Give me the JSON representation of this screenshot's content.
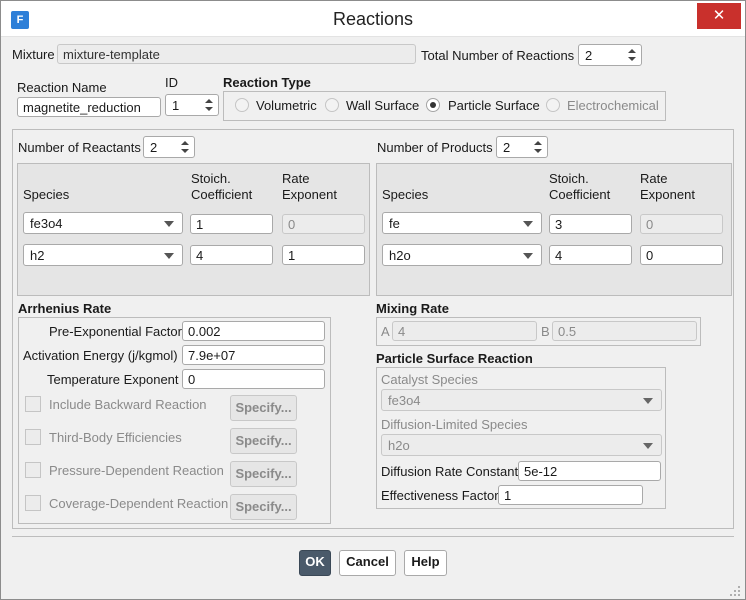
{
  "window": {
    "title": "Reactions",
    "app_icon": "F",
    "close_glyph": "✕"
  },
  "mixture": {
    "label": "Mixture",
    "value": "mixture-template"
  },
  "total_reactions": {
    "label": "Total Number of Reactions",
    "value": "2"
  },
  "reaction_name": {
    "label": "Reaction Name",
    "value": "magnetite_reduction"
  },
  "id": {
    "label": "ID",
    "value": "1"
  },
  "reaction_type": {
    "label": "Reaction Type",
    "options": [
      {
        "label": "Volumetric",
        "selected": false,
        "enabled": true
      },
      {
        "label": "Wall Surface",
        "selected": false,
        "enabled": true
      },
      {
        "label": "Particle Surface",
        "selected": true,
        "enabled": true
      },
      {
        "label": "Electrochemical",
        "selected": false,
        "enabled": false
      }
    ]
  },
  "reactants": {
    "count_label": "Number of Reactants",
    "count": "2",
    "headers": {
      "species": "Species",
      "stoich": "Stoich.\nCoefficient",
      "rate": "Rate\nExponent"
    },
    "rows": [
      {
        "species": "fe3o4",
        "stoich": "1",
        "rate": "0",
        "rate_enabled": false
      },
      {
        "species": "h2",
        "stoich": "4",
        "rate": "1",
        "rate_enabled": true
      }
    ]
  },
  "products": {
    "count_label": "Number of Products",
    "count": "2",
    "headers": {
      "species": "Species",
      "stoich": "Stoich.\nCoefficient",
      "rate": "Rate\nExponent"
    },
    "rows": [
      {
        "species": "fe",
        "stoich": "3",
        "rate": "0",
        "rate_enabled": false
      },
      {
        "species": "h2o",
        "stoich": "4",
        "rate": "0",
        "rate_enabled": true
      }
    ]
  },
  "arrhenius": {
    "label": "Arrhenius Rate",
    "pre_exp": {
      "label": "Pre-Exponential Factor",
      "value": "0.002"
    },
    "activation": {
      "label": "Activation Energy (j/kgmol)",
      "value": "7.9e+07"
    },
    "temp_exp": {
      "label": "Temperature Exponent",
      "value": "0"
    },
    "options": [
      {
        "label": "Include Backward Reaction",
        "button": "Specify..."
      },
      {
        "label": "Third-Body Efficiencies",
        "button": "Specify..."
      },
      {
        "label": "Pressure-Dependent Reaction",
        "button": "Specify..."
      },
      {
        "label": "Coverage-Dependent Reaction",
        "button": "Specify..."
      }
    ]
  },
  "mixing": {
    "label": "Mixing Rate",
    "a_label": "A",
    "a_value": "4",
    "b_label": "B",
    "b_value": "0.5"
  },
  "particle": {
    "label": "Particle Surface Reaction",
    "catalyst_label": "Catalyst Species",
    "catalyst_value": "fe3o4",
    "diffusion_species_label": "Diffusion-Limited Species",
    "diffusion_species_value": "h2o",
    "diff_rate_label": "Diffusion Rate Constant",
    "diff_rate_value": "5e-12",
    "effectiveness_label": "Effectiveness Factor",
    "effectiveness_value": "1"
  },
  "buttons": {
    "ok": "OK",
    "cancel": "Cancel",
    "help": "Help"
  }
}
